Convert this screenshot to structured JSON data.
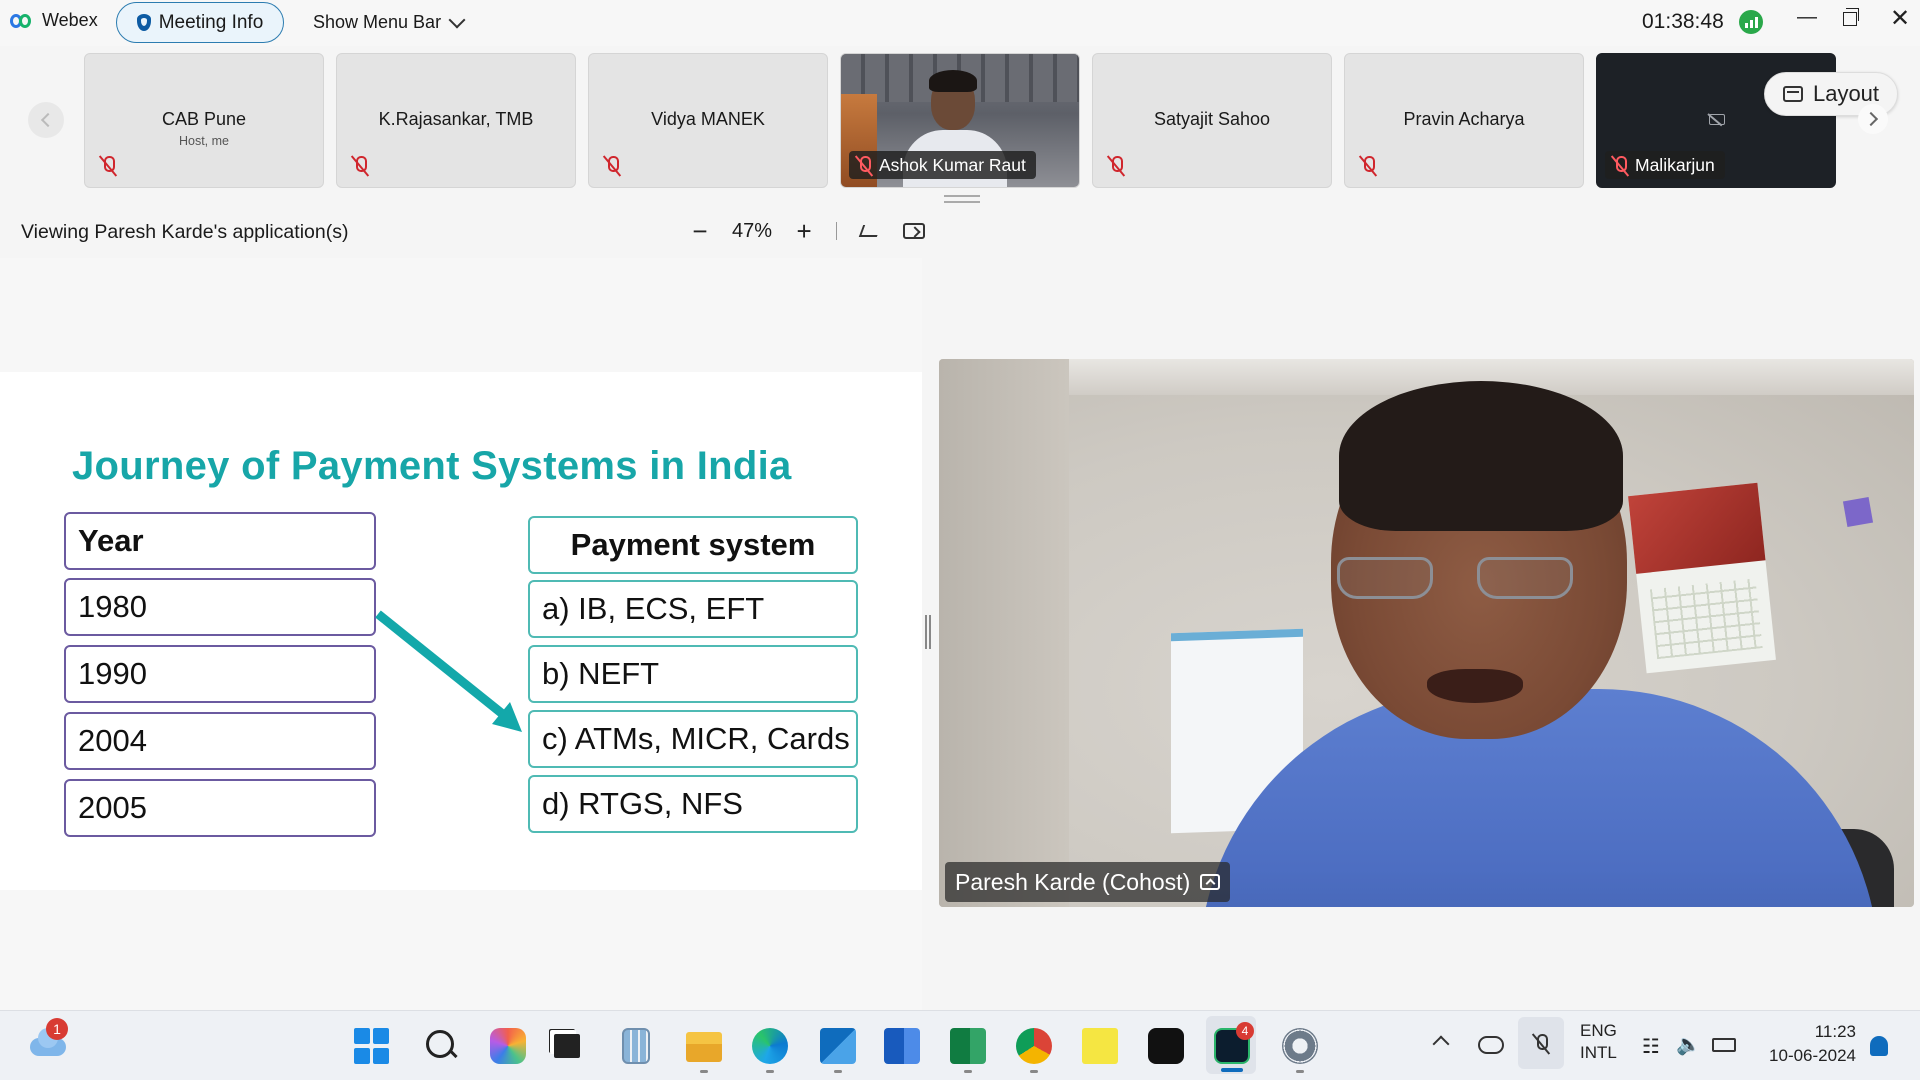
{
  "app": {
    "name": "Webex",
    "meeting_info_label": "Meeting Info",
    "show_menu_label": "Show Menu Bar",
    "timer": "01:38:48"
  },
  "participants": [
    {
      "name": "CAB Pune",
      "subtitle": "Host, me",
      "video": false
    },
    {
      "name": "K.Rajasankar, TMB",
      "video": false
    },
    {
      "name": "Vidya MANEK",
      "video": false
    },
    {
      "name": "Ashok Kumar Raut",
      "video": true
    },
    {
      "name": "Satyajit Sahoo",
      "video": false
    },
    {
      "name": "Pravin Acharya",
      "video": false
    },
    {
      "name": "Malikarjun",
      "video": false,
      "camera_off": true
    }
  ],
  "layout_label": "Layout",
  "share": {
    "viewing_text": "Viewing Paresh Karde's application(s)",
    "zoom_level": "47%"
  },
  "slide": {
    "title": "Journey of Payment Systems in India",
    "year_header": "Year",
    "years": [
      "1980",
      "1990",
      "2004",
      "2005"
    ],
    "system_header": "Payment system",
    "systems": [
      "a) IB, ECS, EFT",
      "b) NEFT",
      "c) ATMs, MICR, Cards",
      "d) RTGS, NFS"
    ],
    "title_color": "#17a6a8",
    "arrow_color": "#1fb5b5"
  },
  "speaker": {
    "name": "Paresh Karde (Cohost)"
  },
  "taskbar": {
    "weather_badge": "1",
    "webex_badge": "4",
    "apps": [
      "start-icon",
      "search-icon",
      "copilot-icon",
      "task-view-icon",
      "calculator-icon",
      "file-explorer-icon",
      "edge-icon",
      "outlook-icon",
      "word-icon",
      "excel-icon",
      "chrome-icon",
      "sticky-notes-icon",
      "webex-icon",
      "webex-meetings-icon",
      "settings-icon"
    ],
    "lang_line1": "ENG",
    "lang_line2": "INTL",
    "time": "11:23",
    "date": "10-06-2024"
  }
}
